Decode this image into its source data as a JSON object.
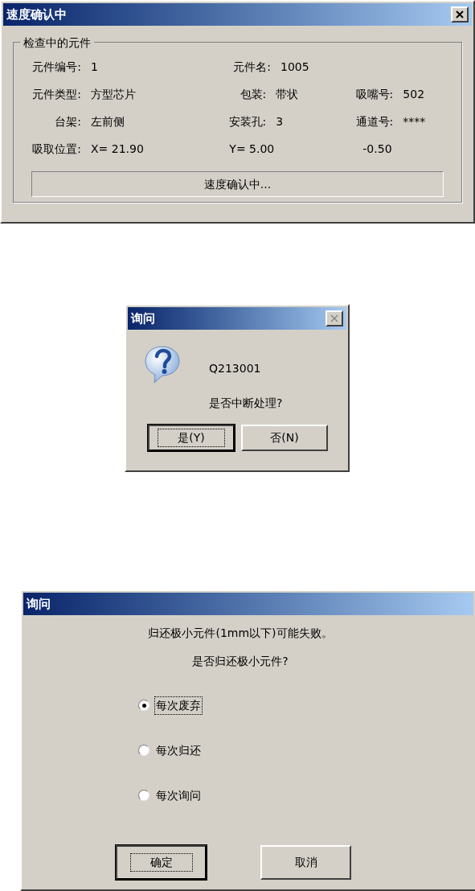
{
  "status_dialog": {
    "title": "速度确认中",
    "close_button": {
      "disabled": false
    },
    "group_title": "检查中的元件",
    "rows": [
      {
        "cells": [
          {
            "label": "元件编号:",
            "value": "1"
          },
          {
            "label": "元件名:",
            "value": "1005"
          }
        ]
      },
      {
        "cells": [
          {
            "label": "元件类型:",
            "value": "方型芯片"
          },
          {
            "label": "包装:",
            "value": "带状"
          },
          {
            "label": "吸嘴号:",
            "value": "502"
          }
        ]
      },
      {
        "cells": [
          {
            "label": "台架:",
            "value": "左前侧"
          },
          {
            "label": "安装孔:",
            "value": "3"
          },
          {
            "label": "通道号:",
            "value": "****"
          }
        ]
      },
      {
        "cells": [
          {
            "label": "吸取位置:",
            "value": "X= 21.90"
          },
          {
            "value": "Y= 5.00"
          },
          {
            "value": "-0.50"
          }
        ]
      }
    ],
    "status": "速度确认中..."
  },
  "confirm_dialog": {
    "title": "询问",
    "close_button": {
      "disabled": true
    },
    "code": "Q213001",
    "message": "是否中断处理?",
    "buttons": [
      {
        "label": "是(Y)",
        "default": true
      },
      {
        "label": "否(N)",
        "default": false
      }
    ]
  },
  "return_dialog": {
    "title": "询问",
    "messages": [
      "归还极小元件(1mm以下)可能失败。",
      "是否归还极小元件?"
    ],
    "options": [
      {
        "label": "每次废弃",
        "selected": true
      },
      {
        "label": "每次归还",
        "selected": false
      },
      {
        "label": "每次询问",
        "selected": false
      }
    ],
    "buttons": [
      {
        "label": "确定",
        "default": true
      },
      {
        "label": "取消",
        "default": false
      }
    ]
  }
}
